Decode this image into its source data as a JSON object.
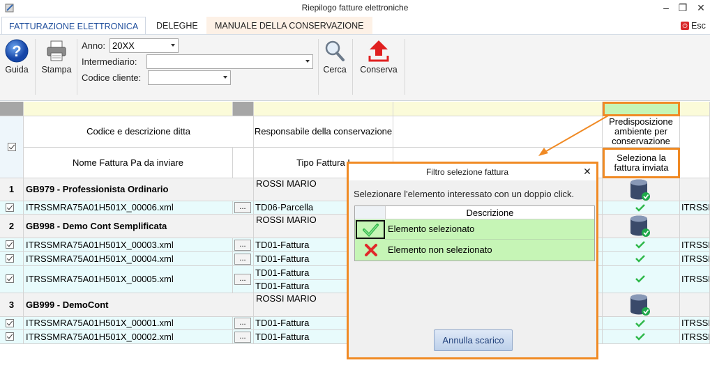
{
  "window": {
    "title": "Riepilogo fatture elettroniche",
    "minimize": "–",
    "restore": "❐",
    "close": "✕"
  },
  "tabs": [
    {
      "label": "FATTURAZIONE ELETTRONICA",
      "active": true
    },
    {
      "label": "DELEGHE",
      "active": false
    },
    {
      "label": "MANUALE DELLA CONSERVAZIONE",
      "active": false
    }
  ],
  "exit_label": "Esc",
  "ribbon": {
    "guida": "Guida",
    "stampa": "Stampa",
    "anno_label": "Anno:",
    "anno_value": "20XX",
    "intermediario_label": "Intermediario:",
    "intermediario_value": "",
    "codice_label": "Codice cliente:",
    "codice_value": "",
    "cerca": "Cerca",
    "conserva": "Conserva"
  },
  "headers": {
    "codice_ditta": "Codice e descrizione ditta",
    "responsabile": "Responsabile della conservazione",
    "nome_fattura": "Nome Fattura Pa da inviare",
    "tipo_fattura": "Tipo Fattura I",
    "predisposizione": "Predisposizione ambiente per conservazione",
    "seleziona": "Seleziona la fattura inviata"
  },
  "groups": [
    {
      "num": "1",
      "name": "GB979 - Professionista Ordinario",
      "responsabile": "ROSSI MARIO",
      "rows": [
        {
          "file": "ITRSSMRA75A01H501X_00006.xml",
          "tipo": [
            "TD06-Parcella"
          ],
          "extra": "ITRSSM"
        }
      ]
    },
    {
      "num": "2",
      "name": "GB998 - Demo Cont Semplificata",
      "responsabile": "ROSSI MARIO",
      "rows": [
        {
          "file": "ITRSSMRA75A01H501X_00003.xml",
          "tipo": [
            "TD01-Fattura"
          ],
          "extra": "ITRSSM"
        },
        {
          "file": "ITRSSMRA75A01H501X_00004.xml",
          "tipo": [
            "TD01-Fattura"
          ],
          "extra": "ITRSSM"
        },
        {
          "file": "ITRSSMRA75A01H501X_00005.xml",
          "tipo": [
            "TD01-Fattura",
            "TD01-Fattura"
          ],
          "extra": "ITRSSM"
        }
      ]
    },
    {
      "num": "3",
      "name": "GB999 - DemoCont",
      "responsabile": "ROSSI MARIO",
      "rows": [
        {
          "file": "ITRSSMRA75A01H501X_00001.xml",
          "tipo": [
            "TD01-Fattura"
          ],
          "extra": "ITRSSM"
        },
        {
          "file": "ITRSSMRA75A01H501X_00002.xml",
          "tipo": [
            "TD01-Fattura"
          ],
          "extra": "ITRSSM"
        }
      ]
    }
  ],
  "dots_label": "...",
  "dialog": {
    "title": "Filtro selezione fattura",
    "close": "✕",
    "instruction": "Selezionare l'elemento interessato con un doppio click.",
    "column": "Descrizione",
    "items": [
      {
        "label": "Elemento selezionato",
        "icon": "check-icon"
      },
      {
        "label": "Elemento non selezionato",
        "icon": "cross-icon"
      }
    ],
    "button": "Annulla scarico"
  },
  "colors": {
    "accent": "#f08a24",
    "row_green": "#c6f5b6",
    "row_blue": "#e8fbfc",
    "tab_text": "#1f4e9c"
  }
}
